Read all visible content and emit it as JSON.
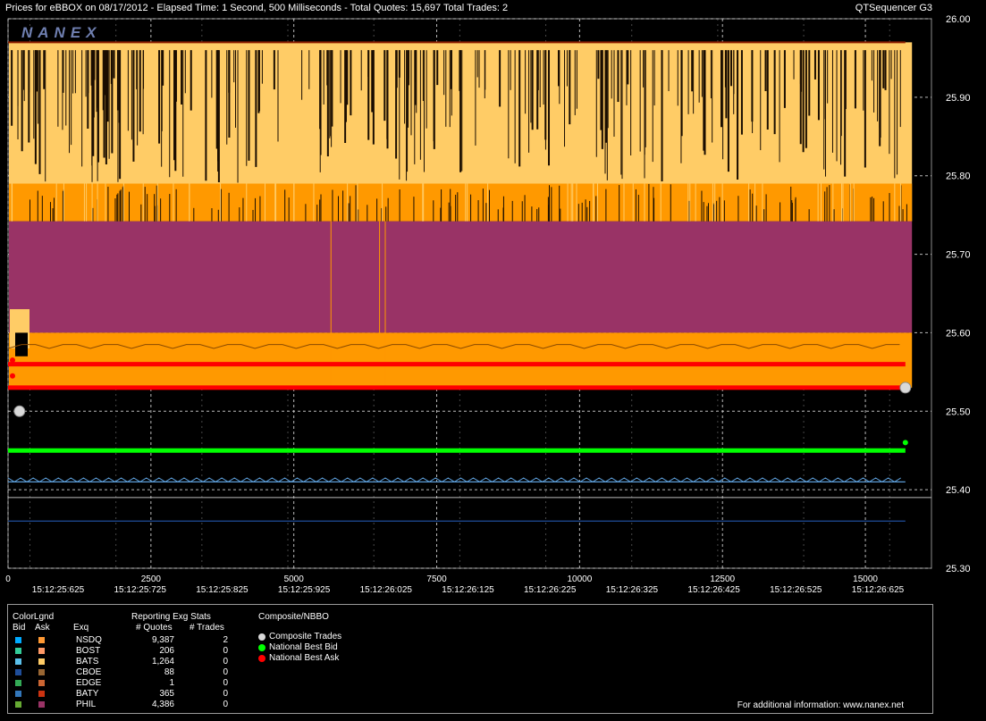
{
  "header": {
    "title": "Prices for  eBBOX  on  08/17/2012  -  Elapsed Time: 1 Second, 500 Milliseconds  -  Total Quotes: 15,697  Total Trades: 2",
    "product": "QTSequencer G3",
    "logo_text": "NANEX"
  },
  "chart_data": {
    "type": "line",
    "title": "Prices for  eBBOX  on  08/17/2012  -  Elapsed Time: 1 Second, 500 Milliseconds  -  Total Quotes: 15,697  Total Trades: 2",
    "xlabel": "",
    "ylabel": "",
    "xlim": [
      0,
      16000
    ],
    "ylim": [
      25.3,
      26.0
    ],
    "x_ticks": [
      "0",
      "2500",
      "5000",
      "7500",
      "10000",
      "12500",
      "15000"
    ],
    "x_tick_values": [
      0,
      2500,
      5000,
      7500,
      10000,
      12500,
      15000
    ],
    "time_labels": [
      "15:12:25:625",
      "15:12:25:725",
      "15:12:25:825",
      "15:12:25:925",
      "15:12:26:025",
      "15:12:26:125",
      "15:12:26:225",
      "15:12:26:325",
      "15:12:26:425",
      "15:12:26:525",
      "15:12:26:625"
    ],
    "time_label_x": [
      460,
      2265,
      4070,
      5875,
      7680,
      9485,
      11290,
      13095,
      14900,
      16705,
      18510
    ],
    "y_ticks": [
      "26.00",
      "25.90",
      "25.80",
      "25.70",
      "25.60",
      "25.50",
      "25.40",
      "25.30"
    ],
    "y_tick_values": [
      26.0,
      25.9,
      25.8,
      25.7,
      25.6,
      25.5,
      25.4,
      25.3
    ],
    "grid": true,
    "bands": [
      {
        "name": "BOST",
        "side": "ask",
        "from": 25.742,
        "to": 25.97,
        "color": "#ffcc66"
      },
      {
        "name": "NSDQ",
        "side": "ask",
        "from": 25.742,
        "to": 25.79,
        "color": "#ff9900"
      },
      {
        "name": "PHIL",
        "side": "ask",
        "from": 25.6,
        "to": 25.742,
        "color": "#993366"
      },
      {
        "name": "NSDQ",
        "side": "ask",
        "from": 25.53,
        "to": 25.6,
        "color": "#ff9900"
      }
    ],
    "series": [
      {
        "name": "National Best Ask",
        "color": "#ff0000",
        "x": [
          0,
          15700
        ],
        "values": [
          25.56,
          25.56
        ]
      },
      {
        "name": "National Best Ask",
        "color": "#ff0000",
        "x": [
          0,
          15700
        ],
        "values": [
          25.53,
          25.53
        ]
      },
      {
        "name": "National Best Bid",
        "color": "#00ff00",
        "x": [
          0,
          15700
        ],
        "values": [
          25.45,
          25.45
        ]
      },
      {
        "name": "BATY",
        "color": "#8c1f00",
        "x": [
          0,
          15700
        ],
        "values": [
          25.97,
          25.97
        ]
      },
      {
        "name": "BATS",
        "color": "#5b9bd5",
        "x": [
          0,
          15700
        ],
        "values": [
          25.41,
          25.41
        ]
      },
      {
        "name": "CBOE",
        "color": "#1f4e9a",
        "x": [
          0,
          15700
        ],
        "values": [
          25.36,
          25.36
        ]
      }
    ],
    "trades": [
      {
        "x": 200,
        "price": 25.5
      },
      {
        "x": 15700,
        "price": 25.53
      }
    ],
    "reference_lines": [
      25.39
    ]
  },
  "legend": {
    "colorlgnd_label": "ColorLgnd",
    "bid_label": "Bid",
    "ask_label": "Ask",
    "exq_label": "Exq",
    "stats_title": "Reporting Exg Stats",
    "quotes_label": "# Quotes",
    "trades_label": "# Trades",
    "composite_title": "Composite/NBBO",
    "exchanges": [
      {
        "name": "NSDQ",
        "bid_color": "#00aaff",
        "ask_color": "#ff9933",
        "quotes": "9,387",
        "trades": "2"
      },
      {
        "name": "BOST",
        "bid_color": "#33cc99",
        "ask_color": "#ff9966",
        "quotes": "206",
        "trades": "0"
      },
      {
        "name": "BATS",
        "bid_color": "#5bc0eb",
        "ask_color": "#ffcc66",
        "quotes": "1,264",
        "trades": "0"
      },
      {
        "name": "CBOE",
        "bid_color": "#1f4e9a",
        "ask_color": "#996633",
        "quotes": "88",
        "trades": "0"
      },
      {
        "name": "EDGE",
        "bid_color": "#33aa55",
        "ask_color": "#cc6633",
        "quotes": "1",
        "trades": "0"
      },
      {
        "name": "BATY",
        "bid_color": "#3377bb",
        "ask_color": "#cc3311",
        "quotes": "365",
        "trades": "0"
      },
      {
        "name": "PHIL",
        "bid_color": "#66aa33",
        "ask_color": "#993366",
        "quotes": "4,386",
        "trades": "0"
      }
    ],
    "composite_items": [
      {
        "label": "Composite Trades",
        "color": "#d9d9d9"
      },
      {
        "label": "National Best Bid",
        "color": "#00ff00"
      },
      {
        "label": "National Best Ask",
        "color": "#ff0000"
      }
    ],
    "footer": "For additional information: www.nanex.net"
  }
}
